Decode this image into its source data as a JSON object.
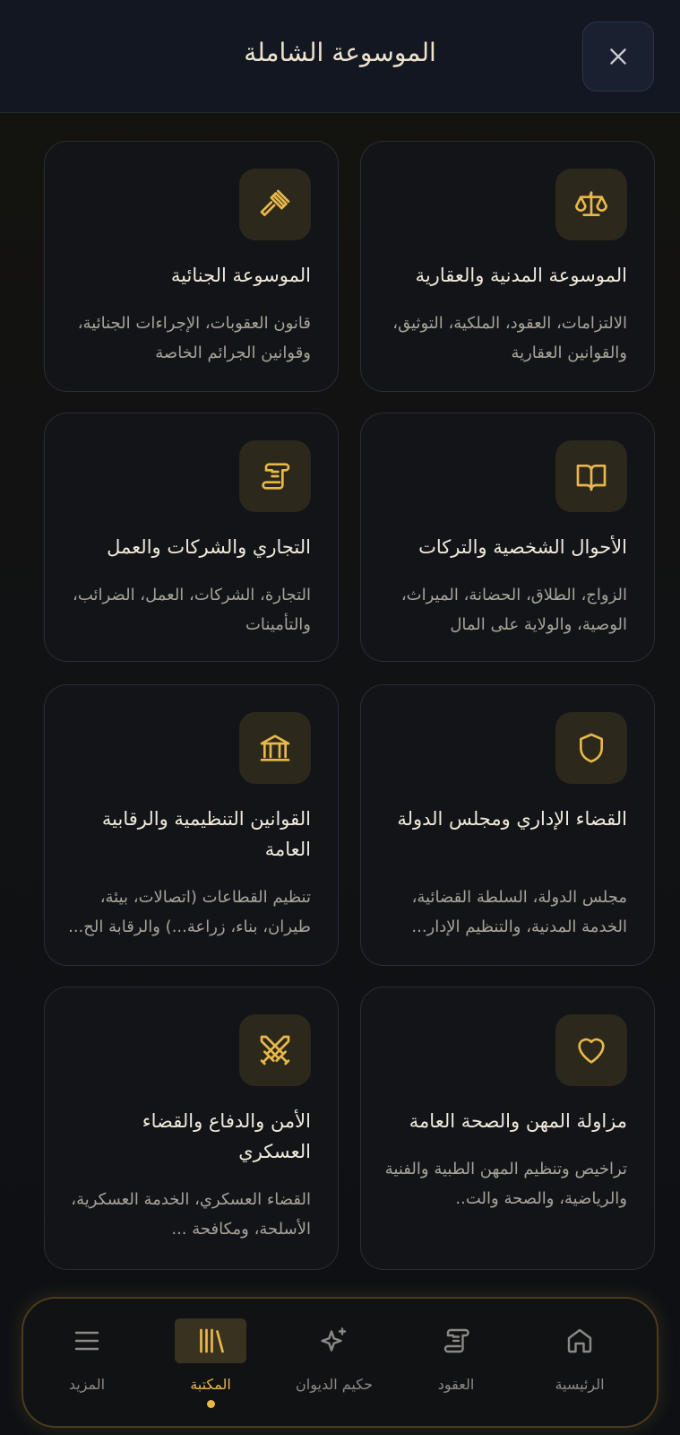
{
  "header": {
    "title": "الموسوعة الشاملة"
  },
  "cards": [
    {
      "title": "الموسوعة المدنية والعقارية",
      "desc": "الالتزامات، العقود، الملكية، التوثيق، والقوانين العقارية",
      "icon": "scales-icon"
    },
    {
      "title": "الموسوعة الجنائية",
      "desc": "قانون العقوبات، الإجراءات الجنائية، وقوانين الجرائم الخاصة",
      "icon": "gavel-icon"
    },
    {
      "title": "الأحوال الشخصية والتركات",
      "desc": "الزواج، الطلاق، الحضانة، الميراث، الوصية، والولاية على المال",
      "icon": "book-icon"
    },
    {
      "title": "التجاري والشركات والعمل",
      "desc": "التجارة، الشركات، العمل، الضرائب، والتأمينات",
      "icon": "scroll-icon"
    },
    {
      "title": "القضاء الإداري ومجلس الدولة",
      "desc": "مجلس الدولة، السلطة القضائية، الخدمة المدنية، والتنظيم الإدار...",
      "icon": "shield-icon"
    },
    {
      "title": "القوانين التنظيمية والرقابية العامة",
      "desc": "تنظيم القطاعات (اتصالات، بيئة، طيران، بناء، زراعة...) والرقابة الح...",
      "icon": "institution-icon"
    },
    {
      "title": "مزاولة المهن والصحة العامة",
      "desc": "تراخيص وتنظيم المهن الطبية والفنية والرياضية، والصحة والت..",
      "icon": "heart-icon"
    },
    {
      "title": "الأمن والدفاع والقضاء العسكري",
      "desc": "القضاء العسكري، الخدمة العسكرية، الأسلحة، ومكافحة ...",
      "icon": "crossed-swords-icon"
    }
  ],
  "nav": [
    {
      "label": "الرئيسية",
      "icon": "home-icon"
    },
    {
      "label": "العقود",
      "icon": "scroll-icon"
    },
    {
      "label": "حكيم الديوان",
      "icon": "sparkles-icon"
    },
    {
      "label": "المكتبة",
      "icon": "library-icon",
      "active": true
    },
    {
      "label": "المزيد",
      "icon": "menu-icon"
    }
  ],
  "colors": {
    "accent": "#e8b84a",
    "background": "#0f1115",
    "card_icon_bg": "#2c281c"
  }
}
